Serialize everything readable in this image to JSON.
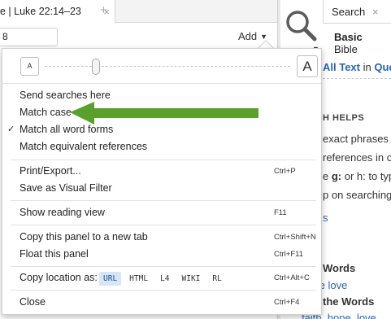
{
  "left_panel": {
    "tab_title": "e | Luke 22:14–23",
    "tab_close": "×",
    "new_tab": "+",
    "reference_value": "8",
    "add_label": "Add",
    "add_caret": "▼"
  },
  "right_panel": {
    "tab_label": "Search",
    "tab_close": "×",
    "mode_tabs": [
      "Basic",
      "Bible"
    ],
    "search_dropdown": "▼",
    "all_text": "All Text",
    "in_text": "in",
    "quote_text": "Quot",
    "help_title": "H HELPS",
    "help_lines": [
      {
        "pre": "exact phrases i",
        "bold": "",
        "post": ""
      },
      {
        "pre": "references in co",
        "bold": "",
        "post": ""
      },
      {
        "pre": "e ",
        "bold": "g:",
        "post": " or h: to type"
      },
      {
        "pre": "p on searching: ",
        "bold": "",
        "post": "V"
      }
    ],
    "help_tail": "s",
    "words_heading_1": "Words",
    "words_link_1": "hope love",
    "words_heading_2": "the Words",
    "words_link_2": "faith, hope, love"
  },
  "menu": {
    "zoom_small": "A",
    "zoom_big": "A",
    "zoom_level": 0.2,
    "items_group1": [
      {
        "label": "Send searches here",
        "checked": false
      },
      {
        "label": "Match case",
        "checked": false
      },
      {
        "label": "Match all word forms",
        "checked": true
      },
      {
        "label": "Match equivalent references",
        "checked": false
      }
    ],
    "check_glyph": "✓",
    "print_label": "Print/Export...",
    "print_shortcut": "Ctrl+P",
    "visual_filter_label": "Save as Visual Filter",
    "reading_label": "Show reading view",
    "reading_shortcut": "F11",
    "copy_panel_label": "Copy this panel to a new tab",
    "copy_panel_shortcut": "Ctrl+Shift+N",
    "float_label": "Float this panel",
    "float_shortcut": "Ctrl+F11",
    "copy_location_label": "Copy location as:",
    "copy_formats": [
      "URL",
      "HTML",
      "L4",
      "WIKI",
      "RL"
    ],
    "copy_location_shortcut": "Ctrl+Alt+C",
    "close_label": "Close",
    "close_shortcut": "Ctrl+F4"
  },
  "colors": {
    "annotation_arrow": "#5aa02c",
    "link": "#2a63b0",
    "format_highlight": "#d6e6f7"
  }
}
